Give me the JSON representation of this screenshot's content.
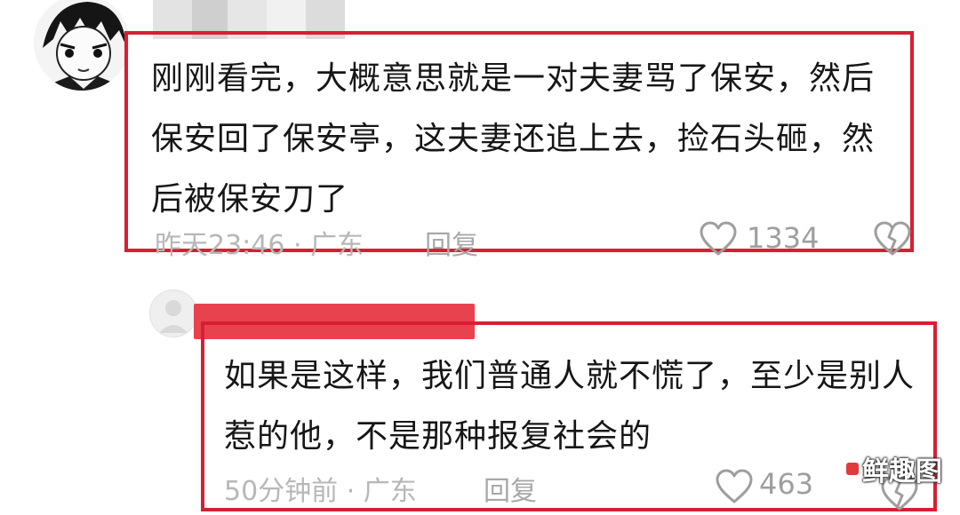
{
  "comments": [
    {
      "text": "刚刚看完，大概意思就是一对夫妻骂了保安，然后保安回了保安亭，这夫妻还追上去，捡石头砸，然后被保安刀了",
      "meta": "昨天23:46 · 广东",
      "reply_label": "回复",
      "like_count": "1334",
      "icons": {
        "like": "heart-icon",
        "dislike": "broken-heart-icon"
      }
    },
    {
      "text": "如果是这样，我们普通人就不慌了，至少是别人惹的他，不是那种报复社会的",
      "meta": "50分钟前 · 广东",
      "reply_label": "回复",
      "like_count": "463",
      "icons": {
        "like": "heart-icon",
        "dislike": "broken-heart-icon"
      }
    }
  ],
  "watermark": {
    "text": "鲜趣图"
  },
  "colors": {
    "highlight_border": "#d71f34",
    "meta_text": "#b7b7b7",
    "name_redaction": "#e8424e"
  }
}
